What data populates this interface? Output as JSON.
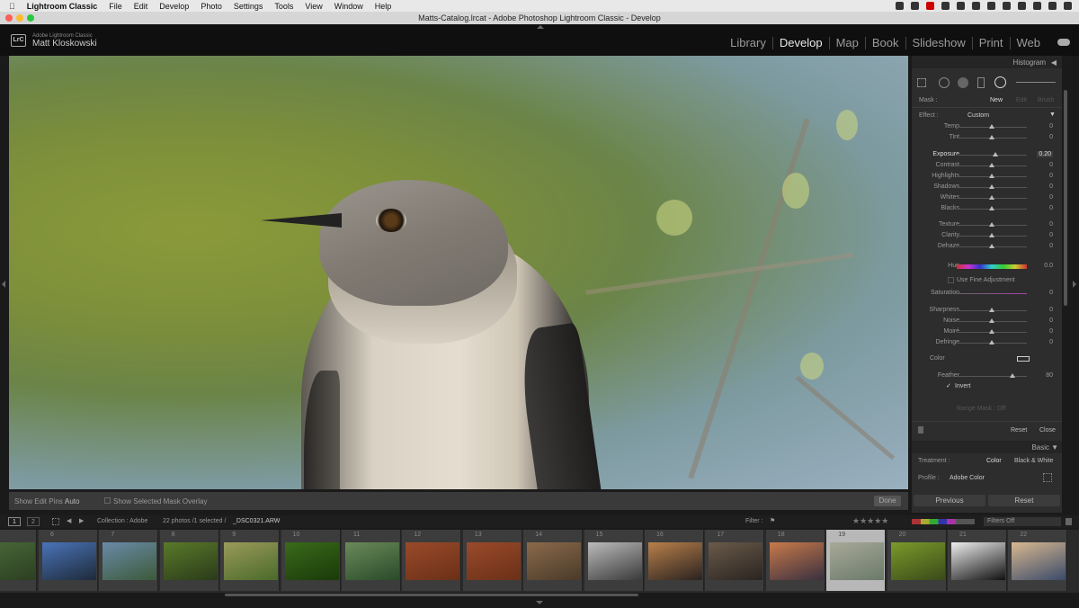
{
  "menubar": {
    "app": "Lightroom Classic",
    "items": [
      "File",
      "Edit",
      "Develop",
      "Photo",
      "Settings",
      "Tools",
      "View",
      "Window",
      "Help"
    ]
  },
  "window": {
    "title": "Matts-Catalog.lrcat - Adobe Photoshop Lightroom Classic - Develop"
  },
  "identity": {
    "logo": "LrC",
    "product": "Adobe Lightroom Classic",
    "user": "Matt Kloskowski"
  },
  "modules": [
    "Library",
    "Develop",
    "Map",
    "Book",
    "Slideshow",
    "Print",
    "Web"
  ],
  "active_module": "Develop",
  "photo_toolbar": {
    "edit_pins_label": "Show Edit Pins :",
    "edit_pins_value": "Auto",
    "mask_overlay_label": "Show Selected Mask Overlay",
    "done": "Done"
  },
  "panel": {
    "histogram": "Histogram",
    "mask_label": "Mask :",
    "mask_new": "New",
    "mask_edit": "Edit",
    "mask_brush": "Brush",
    "effect_label": "Effect :",
    "effect_value": "Custom",
    "sliders_a": [
      {
        "label": "Temp",
        "value": "0",
        "pos": 0.5
      },
      {
        "label": "Tint",
        "value": "0",
        "pos": 0.5
      }
    ],
    "sliders_b": [
      {
        "label": "Exposure",
        "value": "0.20",
        "pos": 0.55
      },
      {
        "label": "Contrast",
        "value": "0",
        "pos": 0.5
      },
      {
        "label": "Highlights",
        "value": "0",
        "pos": 0.5
      },
      {
        "label": "Shadows",
        "value": "0",
        "pos": 0.5
      },
      {
        "label": "Whites",
        "value": "0",
        "pos": 0.5
      },
      {
        "label": "Blacks",
        "value": "0",
        "pos": 0.5
      }
    ],
    "sliders_c": [
      {
        "label": "Texture",
        "value": "0",
        "pos": 0.5
      },
      {
        "label": "Clarity",
        "value": "0",
        "pos": 0.5
      },
      {
        "label": "Dehaze",
        "value": "0",
        "pos": 0.5
      }
    ],
    "hue": {
      "label": "Hue",
      "value": "0.0",
      "pos": 0.5
    },
    "fine_adjust": "Use Fine Adjustment",
    "saturation": {
      "label": "Saturation",
      "value": "0",
      "pos": 0.5
    },
    "sliders_d": [
      {
        "label": "Sharpness",
        "value": "0",
        "pos": 0.5
      },
      {
        "label": "Noise",
        "value": "0",
        "pos": 0.5
      },
      {
        "label": "Moiré",
        "value": "0",
        "pos": 0.5
      },
      {
        "label": "Defringe",
        "value": "0",
        "pos": 0.5
      }
    ],
    "color_label": "Color",
    "feather": {
      "label": "Feather",
      "value": "80",
      "pos": 0.8
    },
    "invert": "Invert",
    "range_mask": "Range Mask : Off",
    "reset": "Reset",
    "close": "Close",
    "basic": "Basic",
    "treatment_label": "Treatment :",
    "treatment_color": "Color",
    "treatment_bw": "Black & White",
    "profile_label": "Profile :",
    "profile_value": "Adobe Color",
    "previous": "Previous",
    "reset_btn": "Reset"
  },
  "filmbar": {
    "page1": "1",
    "page2": "2",
    "collection": "Collection : Adobe",
    "count": "22 photos /1 selected /",
    "filename": "_DSC0321.ARW",
    "filter_label": "Filter :",
    "filters_off": "Filters Off"
  },
  "filmstrip": [
    {
      "num": "",
      "c1": "#4a6a3a",
      "c2": "#2c3f22"
    },
    {
      "num": "6",
      "c1": "#4a74b8",
      "c2": "#1e2a3a"
    },
    {
      "num": "7",
      "c1": "#6a8aa8",
      "c2": "#3c5a3a"
    },
    {
      "num": "8",
      "c1": "#5a7a2a",
      "c2": "#2a3a1a"
    },
    {
      "num": "9",
      "c1": "#9a9a5a",
      "c2": "#4a6a2a"
    },
    {
      "num": "10",
      "c1": "#3a6a1a",
      "c2": "#1a3a0a"
    },
    {
      "num": "11",
      "c1": "#6a8a5a",
      "c2": "#2a4a2a"
    },
    {
      "num": "12",
      "c1": "#9a4a2a",
      "c2": "#6a3018"
    },
    {
      "num": "13",
      "c1": "#9a4a2a",
      "c2": "#6a3018"
    },
    {
      "num": "14",
      "c1": "#8a6a4a",
      "c2": "#4a3a2a"
    },
    {
      "num": "15",
      "c1": "#bbbbbb",
      "c2": "#3a3a3a"
    },
    {
      "num": "16",
      "c1": "#b8804a",
      "c2": "#2a2220"
    },
    {
      "num": "17",
      "c1": "#6a5a4a",
      "c2": "#2a2420"
    },
    {
      "num": "18",
      "c1": "#c87a4a",
      "c2": "#3a3040"
    },
    {
      "num": "19",
      "c1": "#a8a898",
      "c2": "#6a7a6a"
    },
    {
      "num": "20",
      "c1": "#7a9a2a",
      "c2": "#3a4a1a"
    },
    {
      "num": "21",
      "c1": "#eeeeee",
      "c2": "#111111"
    },
    {
      "num": "22",
      "c1": "#d8b890",
      "c2": "#3a4a6a"
    }
  ]
}
